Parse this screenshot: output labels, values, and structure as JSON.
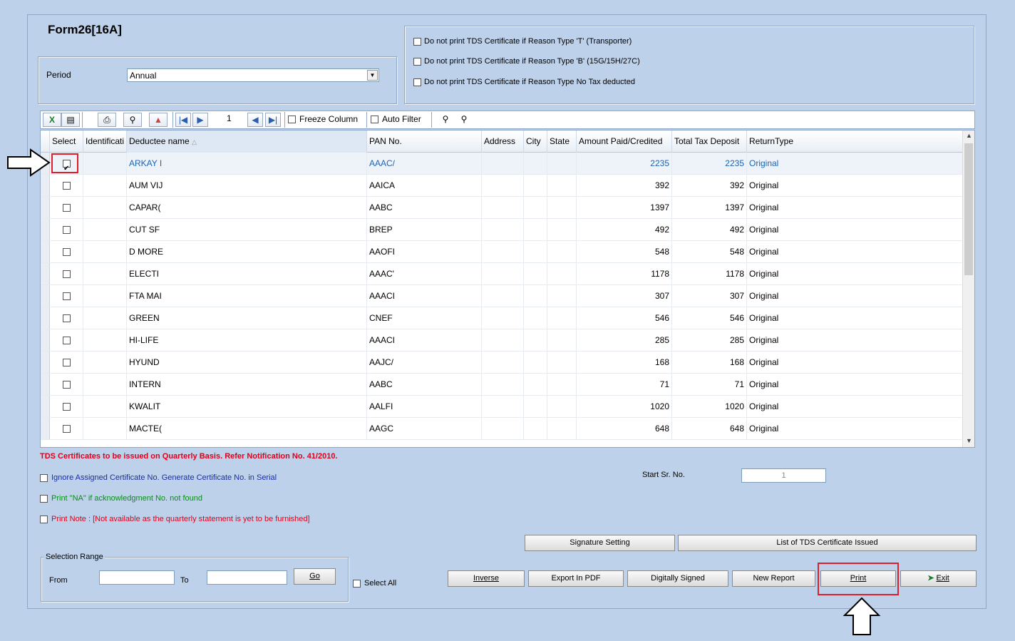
{
  "title": "Form26[16A]",
  "period": {
    "label": "Period",
    "value": "Annual"
  },
  "options": [
    "Do not print TDS Certificate if Reason Type 'T' (Transporter)",
    "Do not print TDS Certificate if Reason Type 'B' (15G/15H/27C)",
    "Do not print TDS Certificate if Reason Type No Tax deducted"
  ],
  "toolbar": {
    "page_number": "1",
    "freeze_column": "Freeze Column",
    "auto_filter": "Auto Filter"
  },
  "grid": {
    "headers": [
      "Select",
      "Identificati",
      "Deductee name",
      "PAN No.",
      "Address",
      "City",
      "State",
      "Amount Paid/Credited",
      "Total Tax Deposit",
      "ReturnType"
    ],
    "rows": [
      {
        "selected": true,
        "name": "ARKAY I",
        "pan": "AAAC/",
        "amount": "2235",
        "tax": "2235",
        "type": "Original"
      },
      {
        "selected": false,
        "name": "AUM VIJ",
        "pan": "AAICA",
        "amount": "392",
        "tax": "392",
        "type": "Original"
      },
      {
        "selected": false,
        "name": "CAPAR(",
        "pan": "AABC",
        "amount": "1397",
        "tax": "1397",
        "type": "Original"
      },
      {
        "selected": false,
        "name": "CUT SF",
        "pan": "BREP",
        "amount": "492",
        "tax": "492",
        "type": "Original"
      },
      {
        "selected": false,
        "name": "D MORE",
        "pan": "AAOFI",
        "amount": "548",
        "tax": "548",
        "type": "Original"
      },
      {
        "selected": false,
        "name": "ELECTI",
        "pan": "AAAC'",
        "amount": "1178",
        "tax": "1178",
        "type": "Original"
      },
      {
        "selected": false,
        "name": "FTA MAI",
        "pan": "AAACI",
        "amount": "307",
        "tax": "307",
        "type": "Original"
      },
      {
        "selected": false,
        "name": "GREEN",
        "pan": "CNEF",
        "amount": "546",
        "tax": "546",
        "type": "Original"
      },
      {
        "selected": false,
        "name": "HI-LIFE",
        "pan": "AAACI",
        "amount": "285",
        "tax": "285",
        "type": "Original"
      },
      {
        "selected": false,
        "name": "HYUND",
        "pan": "AAJC/",
        "amount": "168",
        "tax": "168",
        "type": "Original"
      },
      {
        "selected": false,
        "name": "INTERN",
        "pan": "AABC",
        "amount": "71",
        "tax": "71",
        "type": "Original"
      },
      {
        "selected": false,
        "name": "KWALIT",
        "pan": "AALFI",
        "amount": "1020",
        "tax": "1020",
        "type": "Original"
      },
      {
        "selected": false,
        "name": "MACTE(",
        "pan": "AAGC",
        "amount": "648",
        "tax": "648",
        "type": "Original"
      }
    ]
  },
  "notice": "TDS Certificates to be issued on Quarterly Basis. Refer Notification No. 41/2010.",
  "bottom_options": {
    "ignore_assigned": "Ignore Assigned Certificate No. Generate Certificate No. in Serial",
    "print_na": "Print \"NA\" if acknowledgment No. not found",
    "print_note": "Print Note : [Not available as the quarterly statement is yet to be furnished]"
  },
  "start_sr": {
    "label": "Start Sr. No.",
    "value": "1"
  },
  "selection_range": {
    "legend": "Selection Range",
    "from": "From",
    "to": "To",
    "go": "Go"
  },
  "select_all": "Select All",
  "buttons": {
    "signature_setting": "Signature Setting",
    "list_issued": "List of TDS Certificate Issued",
    "inverse": "Inverse",
    "export_pdf": "Export In PDF",
    "digitally_signed": "Digitally Signed",
    "new_report": "New Report",
    "print": "Print",
    "exit": "Exit"
  },
  "colors": {
    "background": "#bed1ea",
    "highlight_red": "#e01e2a",
    "notice_red": "#e0001a",
    "selected_text": "#1c64b2",
    "blue_option": "#1a2fa0",
    "green_option": "#0c8a1e"
  }
}
